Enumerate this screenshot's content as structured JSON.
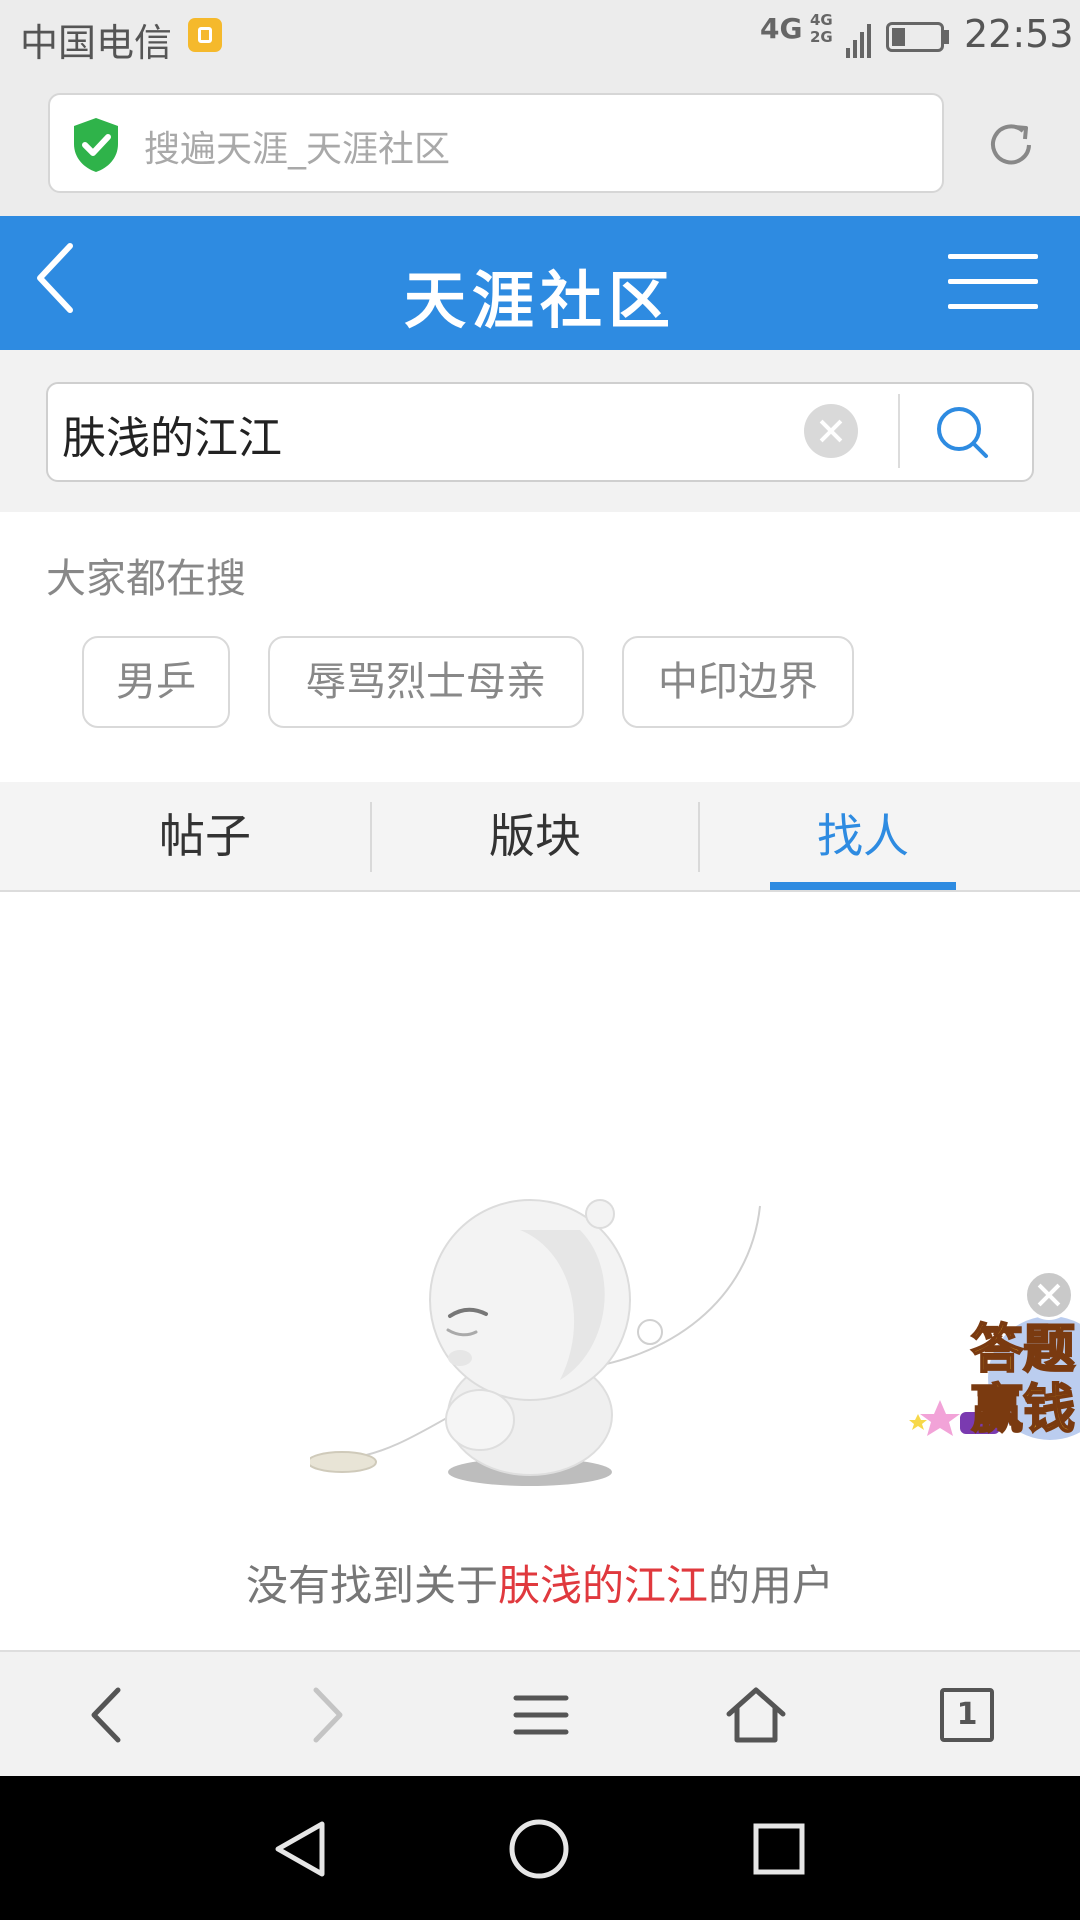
{
  "status_bar": {
    "carrier": "中国电信",
    "network_primary": "4G",
    "network_secondary_top": "4G",
    "network_secondary_bottom": "2G",
    "time": "22:53"
  },
  "browser": {
    "url_title": "搜遍天涯_天涯社区",
    "secure_icon": "shield-check-icon",
    "refresh_icon": "refresh-icon"
  },
  "header": {
    "title": "天涯社区",
    "back_icon": "chevron-left-icon",
    "menu_icon": "hamburger-menu-icon"
  },
  "search": {
    "query": "肤浅的江江",
    "clear_icon": "clear-icon",
    "search_icon": "search-icon"
  },
  "hot_searches": {
    "label": "大家都在搜",
    "items": [
      "男乒",
      "辱骂烈士母亲",
      "中印边界"
    ]
  },
  "tabs": {
    "items": [
      "帖子",
      "版块",
      "找人"
    ],
    "active_index": 2
  },
  "empty_state": {
    "prefix": "没有找到关于",
    "keyword": "肤浅的江江",
    "suffix": "的用户"
  },
  "promo": {
    "text": "答题赢钱"
  },
  "browser_toolbar": {
    "tab_count": "1"
  },
  "colors": {
    "brand_blue": "#2e8be1",
    "keyword_red": "#e0393e",
    "secure_green": "#2fb34a"
  }
}
